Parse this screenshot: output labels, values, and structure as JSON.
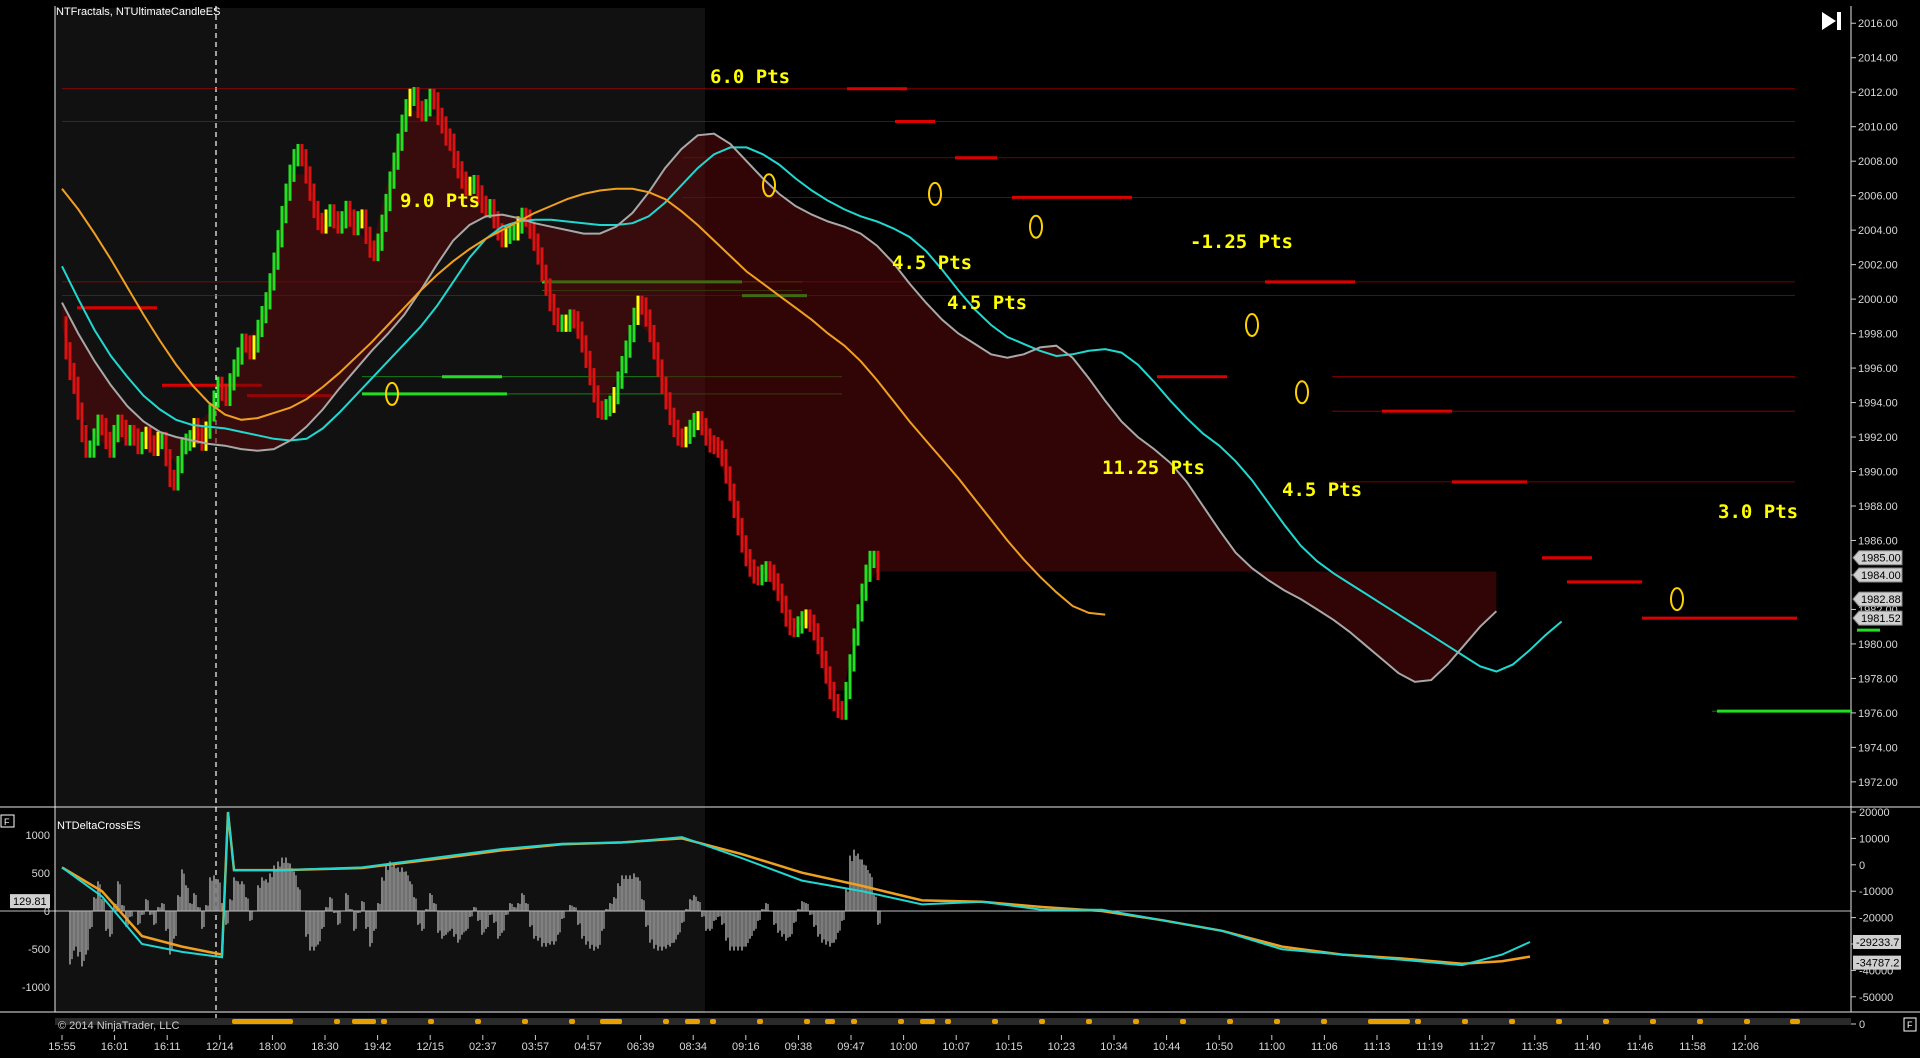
{
  "chart_data": [
    {
      "type": "line",
      "title": "NTFractals, NTUltimateCandleES",
      "ylim": [
        1970.6,
        2017.0
      ],
      "y_ticks": [
        "2016.00",
        "2014.00",
        "2012.00",
        "2010.00",
        "2008.00",
        "2006.00",
        "2004.00",
        "2002.00",
        "2000.00",
        "1998.00",
        "1996.00",
        "1994.00",
        "1992.00",
        "1990.00",
        "1988.00",
        "1986.00",
        "1984.00",
        "1982.00",
        "1980.00",
        "1978.00",
        "1976.00",
        "1974.00",
        "1972.00"
      ],
      "x_labels": [
        "15:55",
        "16:01",
        "16:11",
        "12/14",
        "18:00",
        "18:30",
        "19:42",
        "12/15",
        "02:37",
        "03:57",
        "04:57",
        "06:39",
        "08:34",
        "09:16",
        "09:38",
        "09:47",
        "10:00",
        "10:07",
        "10:15",
        "10:23",
        "10:34",
        "10:44",
        "10:50",
        "11:00",
        "11:06",
        "11:13",
        "11:19",
        "11:27",
        "11:35",
        "11:40",
        "11:46",
        "11:58",
        "12:06"
      ],
      "session_break_label": "12/14",
      "price_series": {
        "name": "ES close",
        "x": [
          0,
          4,
          8,
          12,
          16,
          20,
          24,
          28,
          32,
          36,
          40,
          44,
          48,
          52,
          56,
          60,
          64,
          68,
          72,
          76,
          80,
          84,
          88,
          92,
          96,
          100,
          104,
          108,
          112,
          116,
          120,
          124,
          128,
          132,
          136,
          140,
          144,
          148,
          152,
          156,
          160,
          164,
          168,
          172,
          176,
          180,
          184,
          188,
          192,
          196,
          200,
          204,
          208,
          212,
          216,
          220,
          224,
          228,
          232,
          236,
          240,
          244,
          248,
          252,
          256,
          260,
          264,
          268,
          272,
          276,
          280,
          284,
          288,
          292,
          296,
          300,
          304,
          308,
          312,
          316,
          320,
          324,
          328,
          332,
          336,
          340,
          344,
          348,
          352,
          356,
          360,
          364,
          368,
          372,
          376,
          380,
          384,
          388,
          392,
          396,
          400,
          404,
          408,
          412,
          416,
          420,
          424,
          428,
          432,
          436,
          440,
          444,
          448,
          452,
          456,
          460,
          464,
          468,
          472,
          476,
          480,
          484,
          488,
          492,
          496,
          500,
          504,
          508,
          512,
          516,
          520,
          524,
          528,
          532,
          536,
          540,
          544,
          548,
          552,
          556,
          560,
          564,
          568,
          572,
          576,
          580,
          584,
          588,
          592,
          596,
          600,
          604,
          608,
          612,
          616,
          620,
          624,
          628,
          632,
          636,
          640,
          644,
          648,
          652,
          656,
          660,
          664,
          668,
          672,
          676,
          680,
          684,
          688,
          692,
          696,
          700,
          704,
          708,
          712,
          716,
          720,
          724,
          728,
          732,
          736,
          740,
          744,
          748,
          752,
          756,
          760,
          764,
          768,
          772,
          776,
          780,
          784,
          788,
          792,
          796,
          800,
          804,
          808,
          812,
          816,
          820,
          824,
          828,
          832,
          836,
          840,
          844,
          848,
          852,
          856,
          860,
          864,
          868,
          872,
          876,
          880,
          884,
          888,
          892,
          896,
          900,
          904,
          908,
          912,
          916,
          920,
          924,
          928,
          932,
          936,
          940,
          944,
          948,
          952,
          956,
          960,
          964,
          968,
          972,
          976,
          980,
          984,
          988,
          992,
          996,
          1000,
          1004,
          1008,
          1012,
          1016,
          1020,
          1024,
          1028,
          1032,
          1036,
          1040,
          1044,
          1048,
          1052,
          1056,
          1060,
          1064,
          1068,
          1072,
          1076,
          1080,
          1084,
          1088,
          1092,
          1096,
          1100,
          1104,
          1108,
          1112,
          1116,
          1120,
          1124,
          1128,
          1132,
          1136,
          1140,
          1144,
          1148,
          1152,
          1156,
          1160,
          1164,
          1168,
          1172,
          1176,
          1180,
          1184,
          1188,
          1192,
          1196,
          1200,
          1204,
          1208,
          1212,
          1216,
          1220,
          1224,
          1228,
          1232,
          1236,
          1240,
          1244,
          1248,
          1252,
          1256,
          1260,
          1264,
          1268,
          1272,
          1276,
          1280,
          1284,
          1288,
          1292,
          1296,
          1300,
          1304,
          1308,
          1312,
          1316,
          1320,
          1324,
          1328,
          1332,
          1336,
          1340,
          1344,
          1348,
          1352,
          1356,
          1360,
          1364,
          1368,
          1372,
          1376,
          1380,
          1384,
          1388,
          1392,
          1396,
          1400,
          1404,
          1408,
          1412,
          1416,
          1420,
          1424,
          1428,
          1432,
          1436,
          1440,
          1444,
          1448,
          1452,
          1456,
          1460,
          1464,
          1468
        ],
        "y": [
          1998.5,
          1997.0,
          1995.8,
          1995.0,
          1993.5,
          1992.2,
          1991.3,
          1991.3,
          1992.0,
          1992.8,
          1992.6,
          1991.8,
          1991.3,
          1992.2,
          1992.8,
          1992.5,
          1992.0,
          1992.2,
          1992.0,
          1991.5,
          1991.8,
          1992.1,
          1991.6,
          1991.4,
          1991.8,
          1991.8,
          1990.8,
          1989.6,
          1989.4,
          1990.4,
          1991.5,
          1991.7,
          1991.9,
          1992.6,
          1992.1,
          1991.7,
          1992.4,
          1993.4,
          1994.2,
          1995.0,
          1994.6,
          1994.3,
          1995.2,
          1996.0,
          1996.7,
          1997.5,
          1997.4,
          1997.0,
          1997.4,
          1998.3,
          1999.1,
          1999.9,
          2001.0,
          2002.2,
          2003.5,
          2004.9,
          2006.2,
          2007.3,
          2008.2,
          2008.5,
          2008.2,
          2007.2,
          2006.2,
          2005.2,
          2004.5,
          2004.3,
          2004.7,
          2005.0,
          2004.6,
          2004.3,
          2004.6,
          2005.2,
          2004.7,
          2004.2,
          2004.6,
          2004.7,
          2003.7,
          2002.9,
          2002.7,
          2003.3,
          2004.4,
          2005.6,
          2006.9,
          2008.0,
          2009.1,
          2010.2,
          2011.1,
          2011.7,
          2011.8,
          2011.0,
          2010.8,
          2011.1,
          2011.7,
          2011.5,
          2010.6,
          2010.1,
          2009.4,
          2009.1,
          2008.1,
          2007.5,
          2006.9,
          2006.5,
          2006.6,
          2006.7,
          2006.1,
          2005.5,
          2005.2,
          2005.3,
          2004.6,
          2003.9,
          2003.5,
          2003.7,
          2003.9,
          2003.9,
          2004.3,
          2004.8,
          2004.7,
          2004.0,
          2003.3,
          2002.5,
          2001.5,
          2000.7,
          1999.8,
          1999.0,
          1998.6,
          1998.6,
          1998.6,
          1998.9,
          1998.8,
          1998.2,
          1997.4,
          1996.5,
          1995.5,
          1994.5,
          1993.6,
          1993.5,
          1993.7,
          1993.9,
          1994.4,
          1995.3,
          1996.2,
          1997.1,
          1998.0,
          1999.0,
          1999.7,
          1999.6,
          1998.9,
          1998.0,
          1997.0,
          1996.0,
          1995.0,
          1994.1,
          1993.2,
          1992.5,
          1992.0,
          1991.9,
          1992.1,
          1992.5,
          1992.9,
          1993.0,
          1992.6,
          1992.0,
          1991.6,
          1991.5,
          1991.3,
          1990.8,
          1989.8,
          1988.8,
          1987.8,
          1986.8,
          1985.8,
          1985.0,
          1984.4,
          1984.0,
          1983.9,
          1984.1,
          1984.3,
          1984.1,
          1983.6,
          1983.0,
          1982.3,
          1981.5,
          1981.0,
          1980.9,
          1981.1,
          1981.4,
          1981.5,
          1981.2,
          1980.7,
          1979.9,
          1979.1,
          1978.2,
          1977.3,
          1976.6,
          1976.2,
          1976.1,
          1977.3,
          1978.9,
          1980.4,
          1981.8,
          1983.0,
          1984.1,
          1984.9,
          1984.9,
          1984.2
        ],
        "color": "#3cf03c"
      },
      "moving_averages": [
        {
          "name": "MA fast",
          "color": "#20d8d0",
          "values": [
            2001.9,
            2000.0,
            1998.2,
            1996.7,
            1995.5,
            1994.4,
            1993.6,
            1993.0,
            1992.7,
            1992.6,
            1992.5,
            1992.3,
            1992.1,
            1991.9,
            1991.8,
            1991.9,
            1992.5,
            1993.4,
            1994.4,
            1995.4,
            1996.4,
            1997.4,
            1998.4,
            1999.6,
            2001.0,
            2002.4,
            2003.5,
            2004.2,
            2004.5,
            2004.6,
            2004.6,
            2004.5,
            2004.4,
            2004.3,
            2004.3,
            2004.4,
            2004.8,
            2005.6,
            2006.6,
            2007.6,
            2008.4,
            2008.8,
            2008.8,
            2008.4,
            2007.8,
            2007.0,
            2006.3,
            2005.7,
            2005.2,
            2004.8,
            2004.5,
            2004.1,
            2003.6,
            2002.8,
            2001.7,
            2000.5,
            1999.4,
            1998.5,
            1997.8,
            1997.4,
            1997.0,
            1996.7,
            1996.8,
            1997.0,
            1997.1,
            1996.9,
            1996.2,
            1995.2,
            1994.1,
            1993.1,
            1992.2,
            1991.5,
            1990.6,
            1989.5,
            1988.2,
            1986.9,
            1985.7,
            1984.8,
            1984.1,
            1983.5,
            1982.9,
            1982.3,
            1981.7,
            1981.1,
            1980.5,
            1979.9,
            1979.3,
            1978.7,
            1978.4,
            1978.8,
            1979.6,
            1980.5,
            1981.3
          ]
        },
        {
          "name": "MA mid",
          "color": "#a8a8a8",
          "values": [
            1999.8,
            1998.0,
            1996.4,
            1995.0,
            1993.8,
            1992.9,
            1992.3,
            1992.0,
            1991.8,
            1991.6,
            1991.5,
            1991.3,
            1991.2,
            1991.3,
            1991.8,
            1992.6,
            1993.6,
            1994.8,
            1995.9,
            1997.0,
            1998.0,
            1999.1,
            2000.5,
            2002.0,
            2003.4,
            2004.3,
            2004.8,
            2004.9,
            2004.7,
            2004.4,
            2004.2,
            2004.0,
            2003.8,
            2003.8,
            2004.2,
            2005.0,
            2006.2,
            2007.6,
            2008.7,
            2009.5,
            2009.6,
            2009.0,
            2008.0,
            2007.0,
            2006.1,
            2005.4,
            2004.9,
            2004.5,
            2004.2,
            2003.8,
            2003.1,
            2002.1,
            2000.9,
            1999.8,
            1998.8,
            1998.0,
            1997.4,
            1996.8,
            1996.6,
            1996.8,
            1997.2,
            1997.3,
            1996.6,
            1995.4,
            1994.1,
            1992.9,
            1992.0,
            1991.3,
            1990.5,
            1989.4,
            1988.0,
            1986.6,
            1985.3,
            1984.4,
            1983.7,
            1983.1,
            1982.6,
            1982.0,
            1981.4,
            1980.7,
            1979.9,
            1979.1,
            1978.3,
            1977.8,
            1977.9,
            1978.8,
            1979.9,
            1981.0,
            1981.9
          ]
        },
        {
          "name": "MA slow",
          "color": "#f0a020",
          "values": [
            2006.4,
            2005.2,
            2003.8,
            2002.3,
            2000.7,
            1999.1,
            1997.6,
            1996.2,
            1995.0,
            1994.0,
            1993.3,
            1993.0,
            1993.1,
            1993.4,
            1993.7,
            1994.2,
            1994.9,
            1995.7,
            1996.6,
            1997.5,
            1998.5,
            1999.5,
            2000.5,
            2001.4,
            2002.2,
            2002.9,
            2003.5,
            2004.0,
            2004.5,
            2005.0,
            2005.4,
            2005.8,
            2006.1,
            2006.3,
            2006.4,
            2006.4,
            2006.2,
            2005.8,
            2005.1,
            2004.3,
            2003.4,
            2002.5,
            2001.6,
            2000.9,
            2000.2,
            1999.5,
            1998.8,
            1998.0,
            1997.3,
            1996.4,
            1995.3,
            1994.1,
            1992.9,
            1991.8,
            1990.7,
            1989.6,
            1988.4,
            1987.2,
            1986.0,
            1984.9,
            1983.9,
            1983.0,
            1982.2,
            1981.8,
            1981.7
          ]
        }
      ],
      "resistance_levels": [
        2012.2,
        2010.3,
        2008.2,
        2005.9,
        2001.0,
        2000.2,
        1995.5,
        1993.5,
        1989.4
      ],
      "support_levels": [
        2001.0,
        2000.5,
        1995.5,
        1994.5,
        1976.1
      ],
      "annotations": [
        {
          "text": "9.0 Pts"
        },
        {
          "text": "6.0 Pts"
        },
        {
          "text": "4.5 Pts"
        },
        {
          "text": "4.5 Pts"
        },
        {
          "text": "-1.25 Pts"
        },
        {
          "text": "11.25 Pts"
        },
        {
          "text": "4.5 Pts"
        },
        {
          "text": "3.0 Pts"
        }
      ],
      "price_tags": [
        {
          "value": "1985.00",
          "price": 1985.0
        },
        {
          "value": "1984.00",
          "price": 1984.0
        },
        {
          "value": "1982.88",
          "price": 1982.6
        },
        {
          "value": "1981.52",
          "price": 1981.5
        }
      ]
    },
    {
      "type": "bar",
      "title": "NTDeltaCrossES",
      "left_ticks": [
        "1000",
        "500",
        "0",
        "-500",
        "-1000"
      ],
      "left_tag": "129.81",
      "right_ticks": [
        "20000",
        "10000",
        "0",
        "-10000",
        "-20000",
        "-30000",
        "-40000",
        "-50000",
        "0"
      ],
      "right_tags": [
        "-29233.7",
        "-34787.2"
      ],
      "ylim_left": [
        -1300,
        1300
      ],
      "ylim_right": [
        -55000,
        20000
      ],
      "cumulative_delta": {
        "x": [
          0,
          40,
          80,
          120,
          160,
          166,
          172,
          220,
          300,
          380,
          440,
          500,
          560,
          620,
          680,
          740,
          800,
          860,
          920,
          980,
          1040,
          1100,
          1160,
          1220,
          1280,
          1340,
          1400,
          1440,
          1468
        ],
        "fast": [
          -1000,
          -12000,
          -30000,
          -33000,
          -35000,
          20000,
          -2000,
          -2000,
          -1000,
          3000,
          6000,
          8000,
          8400,
          10500,
          2500,
          -6000,
          -10000,
          -15000,
          -14000,
          -17000,
          -17000,
          -21000,
          -25000,
          -32000,
          -34000,
          -36000,
          -38000,
          -34000,
          -29233.7
        ],
        "slow": [
          -1000,
          -10000,
          -27000,
          -31000,
          -34000,
          20000,
          -2000,
          -2000,
          -1200,
          2500,
          5500,
          7800,
          8500,
          10000,
          4000,
          -3000,
          -8000,
          -13500,
          -14000,
          -16000,
          -17500,
          -21000,
          -25000,
          -31000,
          -34000,
          -35500,
          -37500,
          -36500,
          -34787.2
        ]
      },
      "histogram_color": "#b0b0b0"
    }
  ],
  "copyright": "© 2014 NinjaTrader, LLC",
  "colors": {
    "background": "#000000",
    "highlight_region": "#101010",
    "panel_border": "#ffffff",
    "resistance": "#dd0000",
    "support": "#22dd22",
    "label": "#ffff00",
    "magenta": "#ff00ff"
  },
  "icons": {
    "skip_to_end": "skip-to-end-icon",
    "panel_toggle": "panel-toggle-icon"
  }
}
